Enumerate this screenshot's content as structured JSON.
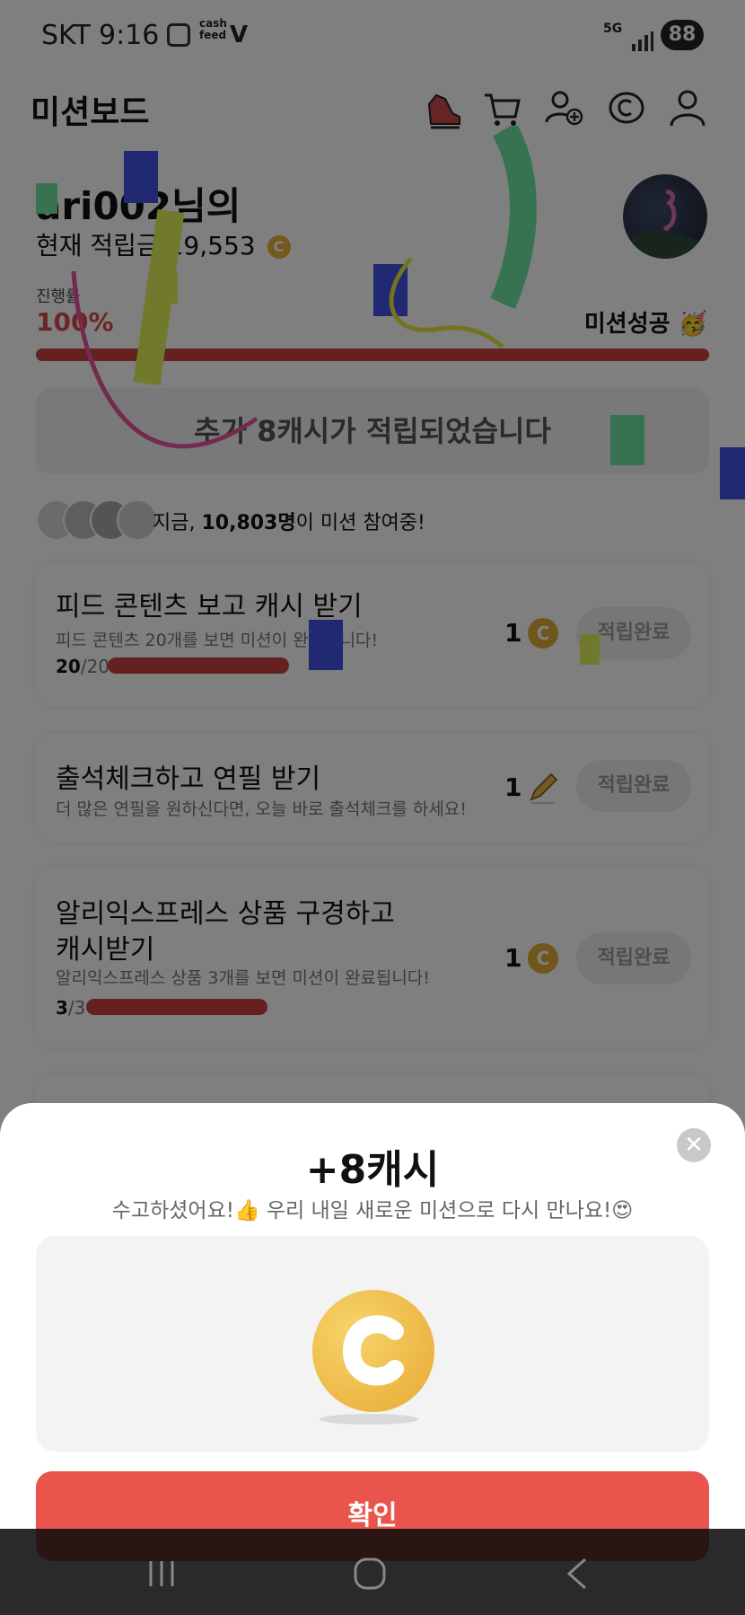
{
  "status_bar": {
    "carrier": "SKT",
    "time": "9:16",
    "app_badge": "cash\nfeed",
    "network": "5G",
    "battery": "88"
  },
  "header": {
    "title": "미션보드",
    "icons": [
      "sneaker-icon",
      "cart-icon",
      "add-friend-icon",
      "cash-coin-icon",
      "profile-icon"
    ]
  },
  "profile": {
    "username": "ari002님의",
    "points_label": "현재 적립금",
    "points_value": "19,553",
    "progress_label": "진행률",
    "progress_value": "100%",
    "progress_fraction": 1.0,
    "status_text": "미션성공 🥳"
  },
  "banner": {
    "text": "추가 8캐시가 적립되었습니다"
  },
  "participants": {
    "prefix": "지금, ",
    "count": "10,803명",
    "suffix": "이 미션 참여중!"
  },
  "missions": [
    {
      "title": "피드 콘텐츠 보고 캐시 받기",
      "desc": "피드 콘텐츠 20개를 보면 미션이 완료됩니다!",
      "reward": "1",
      "reward_type": "coin-icon",
      "button": "적립완료",
      "progress_done": "20",
      "progress_total": "/20",
      "progress_fraction": 1.0
    },
    {
      "title": "출석체크하고 연필 받기",
      "desc": "더 많은 연필을 원하신다면, 오늘 바로 출석체크를 하세요!",
      "reward": "1",
      "reward_type": "pencil-icon",
      "button": "적립완료"
    },
    {
      "title": "알리익스프레스 상품 구경하고\n캐시받기",
      "title_line1": "알리익스프레스 상품 구경하고",
      "title_line2": "캐시받기",
      "desc": "알리익스프레스 상품 3개를 보면 미션이 완료됩니다!",
      "reward": "1",
      "reward_type": "coin-icon",
      "button": "적립완료",
      "progress_done": "3",
      "progress_total": "/3",
      "progress_fraction": 1.0
    }
  ],
  "sheet": {
    "title": "+8캐시",
    "message": "수고하셨어요!👍 우리 내일 새로운 미션으로 다시 만나요!😍",
    "coin_glyph": "C",
    "confirm_button": "확인",
    "close_glyph": "✕"
  },
  "colors": {
    "accent_red": "#e9544d",
    "progress_red": "#c9423f",
    "coin_gold": "#e6a934"
  }
}
